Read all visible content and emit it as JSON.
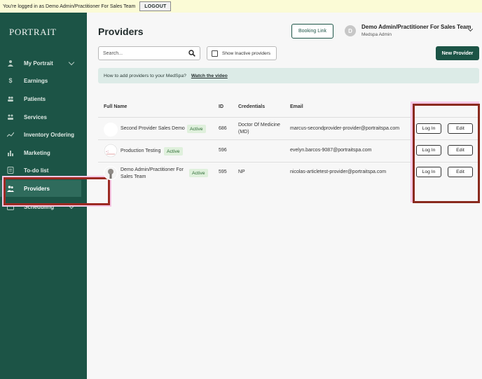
{
  "banner": {
    "message": "You're logged in as Demo Admin/Practitioner For Sales Team",
    "logout_label": "LOGOUT"
  },
  "sidebar": {
    "logo": "PORTRAIT",
    "items": [
      {
        "label": "My Portrait",
        "icon": "person-icon",
        "has_chevron": true
      },
      {
        "label": "Earnings",
        "icon": "dollar-icon",
        "has_chevron": false
      },
      {
        "label": "Patients",
        "icon": "patients-icon",
        "has_chevron": false
      },
      {
        "label": "Services",
        "icon": "services-icon",
        "has_chevron": false
      },
      {
        "label": "Inventory Ordering",
        "icon": "trend-icon",
        "has_chevron": false
      },
      {
        "label": "Marketing",
        "icon": "bar-chart-icon",
        "has_chevron": false
      },
      {
        "label": "To-do list",
        "icon": "list-icon",
        "has_chevron": false
      },
      {
        "label": "Providers",
        "icon": "providers-icon",
        "has_chevron": false,
        "active": true
      },
      {
        "label": "Scheduling",
        "icon": "calendar-icon",
        "has_chevron": true
      }
    ]
  },
  "header": {
    "title": "Providers",
    "booking_link_label": "Booking Link",
    "user_initial": "D",
    "user_name": "Demo Admin/Practitioner For Sales Team",
    "user_role": "Medspa Admin"
  },
  "toolbar": {
    "search_placeholder": "Search...",
    "show_inactive_label": "Show Inactive providers",
    "new_provider_label": "New Provider"
  },
  "info": {
    "question": "How to add providers to your MedSpa?",
    "link_label": "Watch the video"
  },
  "table": {
    "columns": {
      "name": "Full Name",
      "id": "ID",
      "credentials": "Credentials",
      "email": "Email"
    },
    "rows": [
      {
        "name": "Second Provider Sales Demo",
        "status": "Active",
        "id": "686",
        "credentials": "Doctor Of Medicine (MD)",
        "email": "marcus-secondprovider-provider@portraitspa.com",
        "login_label": "Log In",
        "edit_label": "Edit"
      },
      {
        "name": "Production Testing",
        "status": "Active",
        "id": "596",
        "credentials": "",
        "email": "evelyn.barcos-9087@portraitspa.com",
        "login_label": "Log In",
        "edit_label": "Edit"
      },
      {
        "name": "Demo Admin/Practitioner For Sales Team",
        "status": "Active",
        "id": "595",
        "credentials": "NP",
        "email": "nicolas-articletest-provider@portraitspa.com",
        "login_label": "Log In",
        "edit_label": "Edit"
      }
    ]
  },
  "colors": {
    "sidebar_bg": "#1c5446",
    "active_item_bg": "#2f6b5c",
    "primary_button": "#1c5446",
    "active_badge_bg": "#dff0dc",
    "info_bar_bg": "#dcebe7",
    "highlight_box": "#9c2a22"
  }
}
